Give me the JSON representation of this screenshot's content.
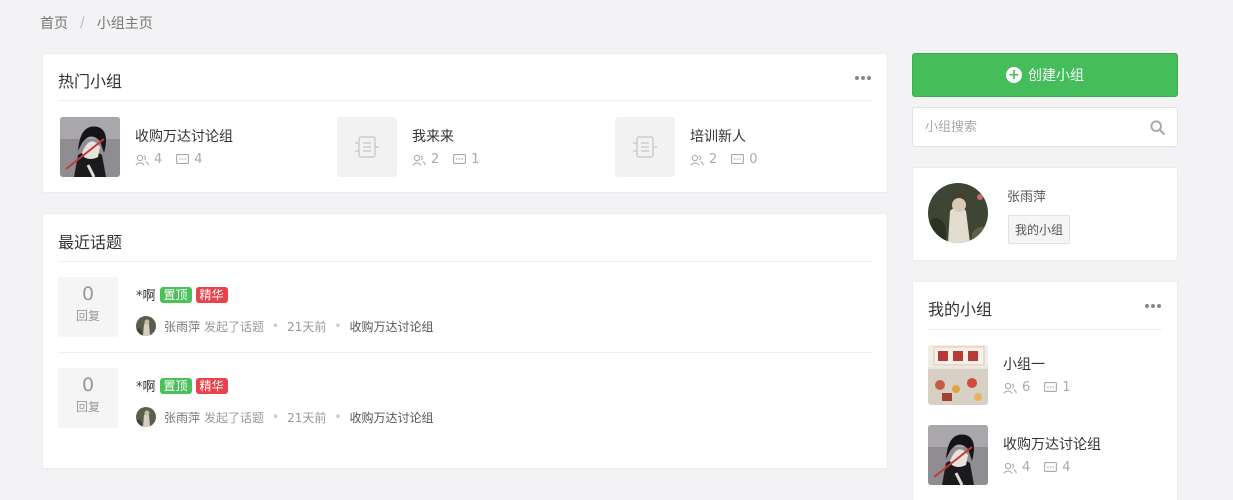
{
  "breadcrumb": {
    "home": "首页",
    "separator": "/",
    "current": "小组主页"
  },
  "hot_groups": {
    "title": "热门小组",
    "items": [
      {
        "name": "收购万达讨论组",
        "members": "4",
        "topics": "4",
        "thumb": "anime"
      },
      {
        "name": "我来来",
        "members": "2",
        "topics": "1",
        "thumb": "placeholder"
      },
      {
        "name": "培训新人",
        "members": "2",
        "topics": "0",
        "thumb": "placeholder"
      }
    ]
  },
  "recent_topics": {
    "title": "最近话题",
    "reply_label": "回复",
    "items": [
      {
        "replies": "0",
        "title": "*啊",
        "tag_top": "置顶",
        "tag_elite": "精华",
        "author": "张雨萍",
        "action": "发起了话题",
        "time": "21天前",
        "group": "收购万达讨论组"
      },
      {
        "replies": "0",
        "title": "*啊",
        "tag_top": "置顶",
        "tag_elite": "精华",
        "author": "张雨萍",
        "action": "发起了话题",
        "time": "21天前",
        "group": "收购万达讨论组"
      }
    ]
  },
  "sidebar": {
    "create_button": "创建小组",
    "search_placeholder": "小组搜索",
    "user": {
      "name": "张雨萍",
      "my_groups_button": "我的小组"
    },
    "my_groups": {
      "title": "我的小组",
      "items": [
        {
          "name": "小组一",
          "members": "6",
          "topics": "1",
          "thumb": "storefront"
        },
        {
          "name": "收购万达讨论组",
          "members": "4",
          "topics": "4",
          "thumb": "anime"
        }
      ]
    }
  },
  "colors": {
    "accent_green": "#45bd5b",
    "tag_green": "#4cc15a",
    "tag_red": "#e8434a"
  }
}
